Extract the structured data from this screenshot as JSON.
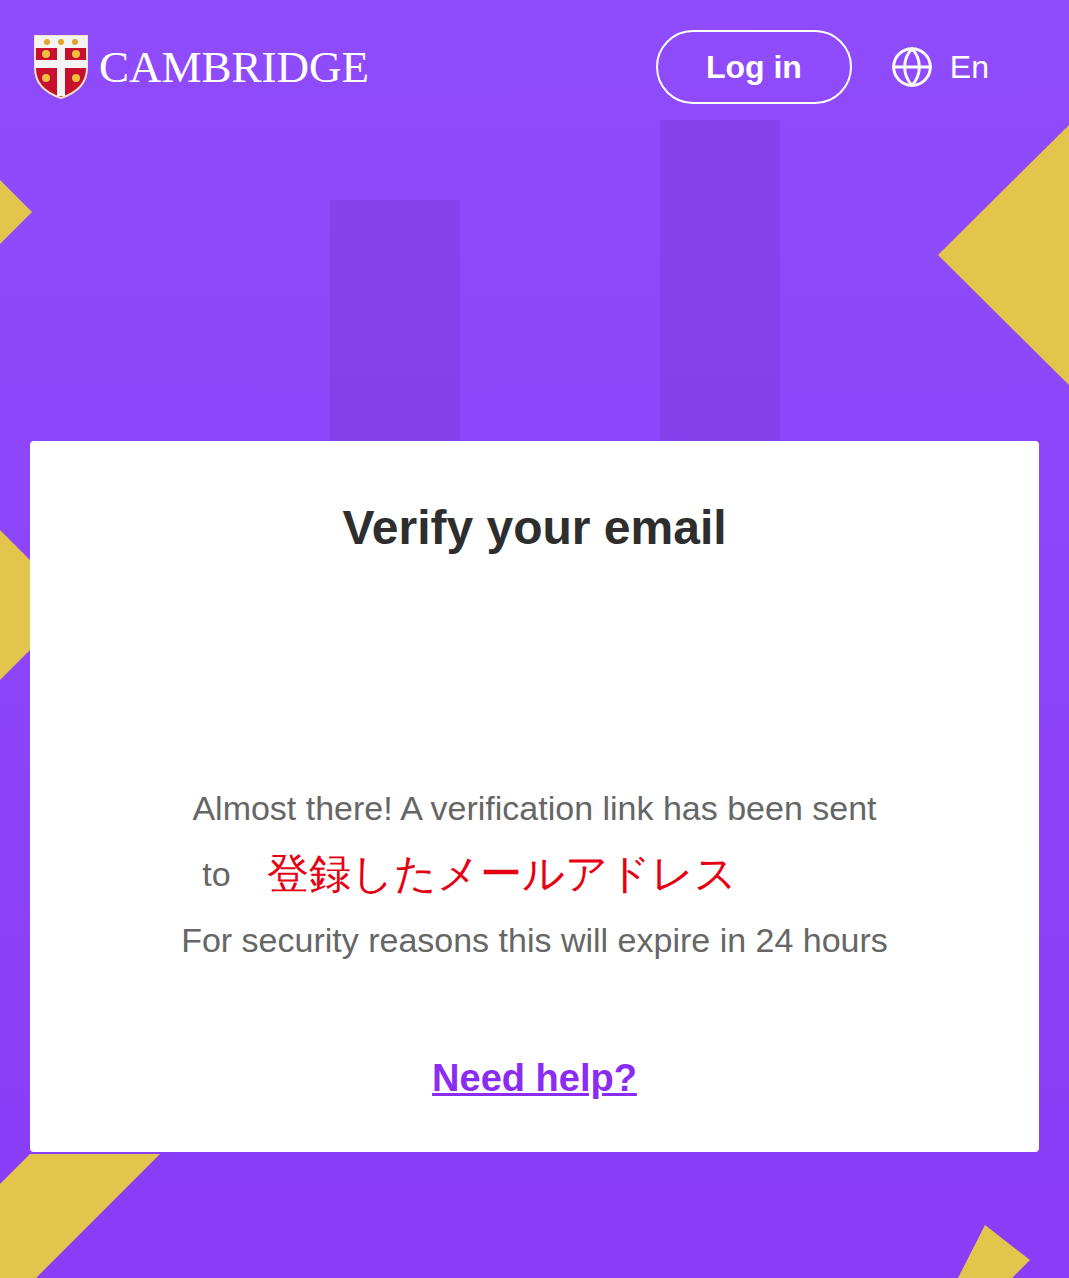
{
  "header": {
    "logo": "CAMBRIDGE",
    "login_button": "Log in",
    "language": "En"
  },
  "card": {
    "title": "Verify your email",
    "line_one": "Almost there! A verification link has been sent",
    "line_two_prefix": "to",
    "email": "登録したメールアドレス",
    "expiry": "For security reasons this will expire in 24 hours",
    "help_link": "Need help?"
  }
}
